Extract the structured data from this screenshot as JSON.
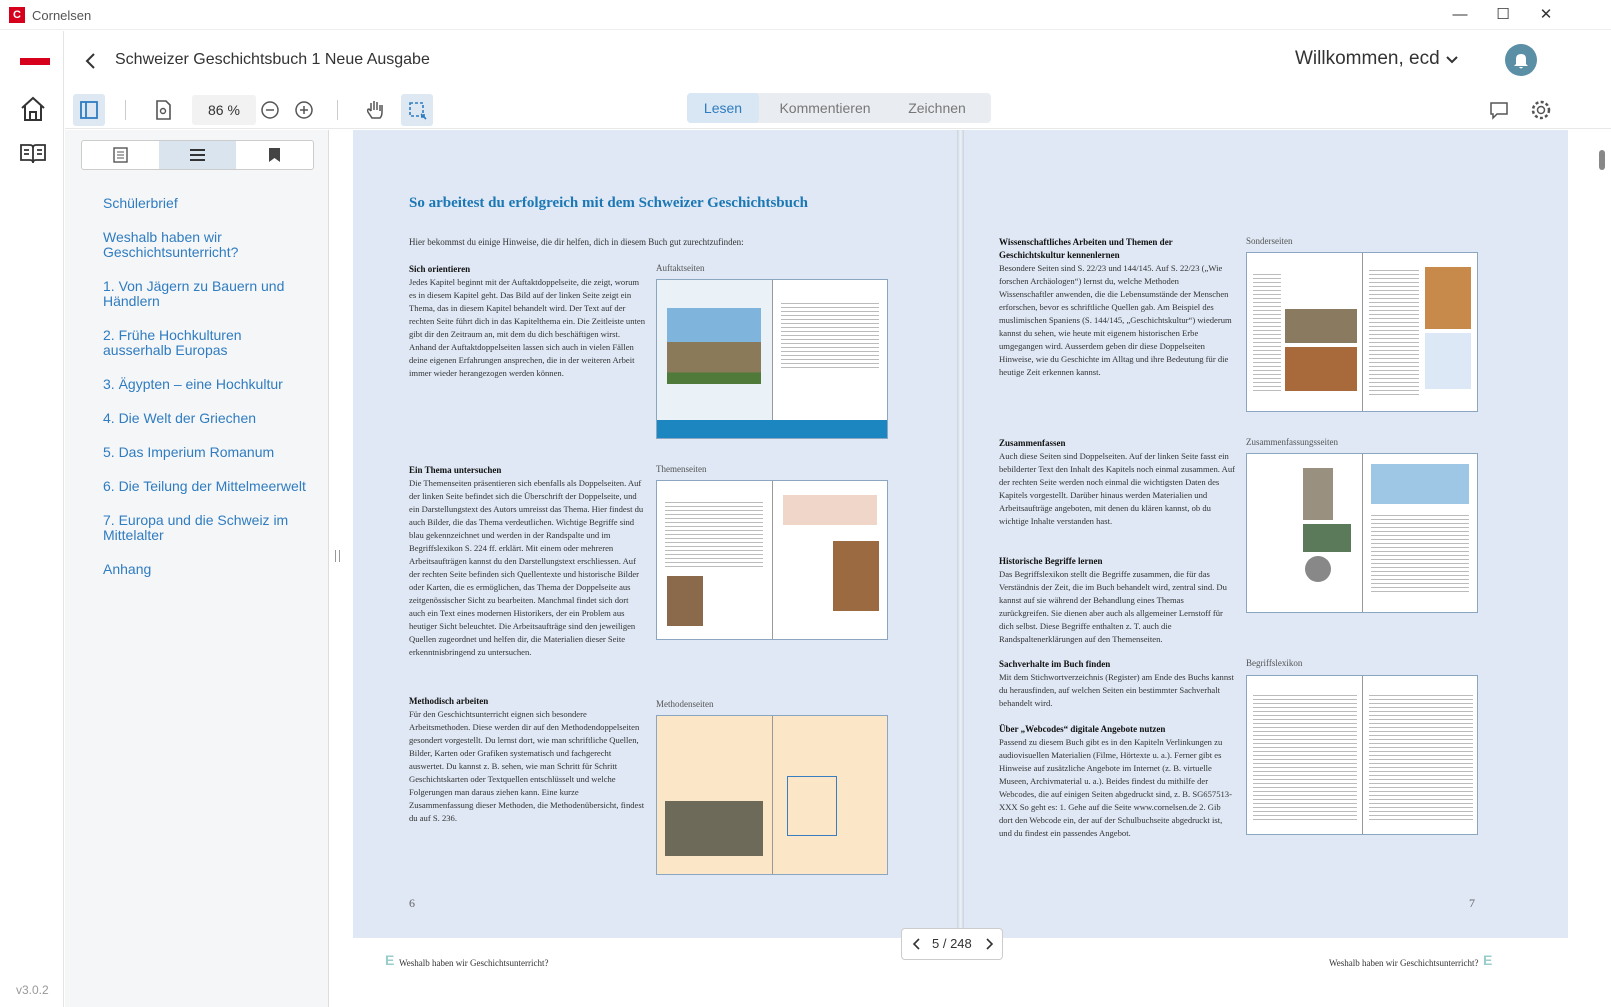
{
  "window": {
    "title": "Cornelsen",
    "logo_letter": "C",
    "minimize": "—",
    "maximize": "☐",
    "close": "✕"
  },
  "rail": {
    "version": "v3.0.2"
  },
  "header": {
    "book_title": "Schweizer Geschichtsbuch 1 Neue Ausgabe",
    "welcome": "Willkommen, ecd"
  },
  "toolbar": {
    "zoom": "86 %",
    "modes": [
      "Lesen",
      "Kommentieren",
      "Zeichnen"
    ],
    "active_mode": "Lesen"
  },
  "toc": {
    "items": [
      "Schülerbrief",
      "Weshalb haben wir Geschichtsunterricht?",
      "1. Von Jägern zu Bauern und Händlern",
      "2. Frühe Hochkulturen ausserhalb Europas",
      "3. Ägypten – eine Hochkultur",
      "4. Die Welt der Griechen",
      "5. Das Imperium Romanum",
      "6. Die Teilung der Mittelmeerwelt",
      "7. Europa und die Schweiz im Mittelalter",
      "Anhang"
    ]
  },
  "left_page": {
    "heading": "So arbeitest du erfolgreich mit dem Schweizer Geschichtsbuch",
    "intro": "Hier bekommst du einige Hinweise, die dir helfen, dich in diesem Buch gut zurechtzufinden:",
    "sections": [
      {
        "title": "Sich orientieren",
        "text": "Jedes Kapitel beginnt mit der Auftaktdoppelseite, die zeigt, worum es in diesem Kapitel geht. Das Bild auf der linken Seite zeigt ein Thema, das in diesem Kapitel behandelt wird. Der Text auf der rechten Seite führt dich in das Kapitelthema ein. Die Zeitleiste unten gibt dir den Zeitraum an, mit dem du dich beschäftigen wirst. Anhand der Auftaktdoppelseiten lassen sich auch in vielen Fällen deine eigenen Erfahrungen ansprechen, die in der weiteren Arbeit immer wieder herangezogen werden können.",
        "thumb_label": "Auftaktseiten"
      },
      {
        "title": "Ein Thema untersuchen",
        "text": "Die Themenseiten präsentieren sich ebenfalls als Doppelseiten. Auf der linken Seite befindet sich die Überschrift der Doppelseite, und ein Darstellungstext des Autors umreisst das Thema. Hier findest du auch Bilder, die das Thema verdeutlichen. Wichtige Begriffe sind blau gekennzeichnet und werden in der Randspalte und im Begriffslexikon S. 224 ff. erklärt. Mit einem oder mehreren Arbeitsaufträgen kannst du den Darstellungstext erschliessen. Auf der rechten Seite befinden sich Quellentexte und historische Bilder oder Karten, die es ermöglichen, das Thema der Doppelseite aus zeitgenössischer Sicht zu bearbeiten. Manchmal findet sich dort auch ein Text eines modernen Historikers, der ein Problem aus heutiger Sicht beleuchtet. Die Arbeitsaufträge sind den jeweiligen Quellen zugeordnet und helfen dir, die Materialien dieser Seite erkenntnisbringend zu untersuchen.",
        "thumb_label": "Themenseiten"
      },
      {
        "title": "Methodisch arbeiten",
        "text": "Für den Geschichtsunterricht eignen sich besondere Arbeitsmethoden. Diese werden dir auf den Methodendoppelseiten gesondert vorgestellt. Du lernst dort, wie man schriftliche Quellen, Bilder, Karten oder Grafiken systematisch und fachgerecht auswertet. Du kannst z. B. sehen, wie man Schritt für Schritt Geschichtskarten oder Textquellen entschlüsselt und welche Folgerungen man daraus ziehen kann. Eine kurze Zusammenfassung dieser Methoden, die Methodenübersicht, findest du auf S. 236.",
        "thumb_label": "Methodenseiten"
      }
    ],
    "page_number": "6",
    "footer": "Weshalb haben wir Geschichtsunterricht?",
    "footer_mark": "E"
  },
  "right_page": {
    "sections": [
      {
        "title": "Wissenschaftliches Arbeiten und Themen der Geschichtskultur kennenlernen",
        "text": "Besondere Seiten sind S. 22/23 und 144/145. Auf S. 22/23 („Wie forschen Archäologen“) lernst du, welche Methoden Wissenschaftler anwenden, die die Lebensumstände der Menschen erforschen, bevor es schriftliche Quellen gab. Am Beispiel des muslimischen Spaniens (S. 144/145, „Geschichtskultur“) wiederum kannst du sehen, wie heute mit eigenem historischen Erbe umgegangen wird. Ausserdem geben dir diese Doppelseiten Hinweise, wie du Geschichte im Alltag und ihre Bedeutung für die heutige Zeit erkennen kannst.",
        "thumb_label": "Sonderseiten"
      },
      {
        "title": "Zusammenfassen",
        "text": "Auch diese Seiten sind Doppelseiten. Auf der linken Seite fasst ein bebilderter Text den Inhalt des Kapitels noch einmal zusammen. Auf der rechten Seite werden noch einmal die wichtigsten Daten des Kapitels vorgestellt. Darüber hinaus werden Materialien und Arbeitsaufträge angeboten, mit denen du klären kannst, ob du wichtige Inhalte verstanden hast.",
        "thumb_label": "Zusammenfassungsseiten"
      },
      {
        "title": "Historische Begriffe lernen",
        "text": "Das Begriffslexikon stellt die Begriffe zusammen, die für das Verständnis der Zeit, die im Buch behandelt wird, zentral sind. Du kannst auf sie während der Behandlung eines Themas zurückgreifen. Sie dienen aber auch als allgemeiner Lernstoff für dich selbst. Diese Begriffe enthalten z. T. auch die Randspaltenerklärungen auf den Themenseiten.",
        "thumb_label": "Begriffslexikon"
      },
      {
        "title": "Sachverhalte im Buch finden",
        "text": "Mit dem Stichwortverzeichnis (Register) am Ende des Buchs kannst du herausfinden, auf welchen Seiten ein bestimmter Sachverhalt behandelt wird."
      },
      {
        "title": "Über „Webcodes“ digitale Angebote nutzen",
        "text": "Passend zu diesem Buch gibt es in den Kapiteln Verlinkungen zu audiovisuellen Materialien (Filme, Hörtexte u. a.). Ferner gibt es Hinweise auf zusätzliche Angebote im Internet (z. B. virtuelle Museen, Archivmaterial u. a.). Beides findest du mithilfe der Webcodes, die auf einigen Seiten abgedruckt sind, z. B. SG657513-XXX So geht es: 1. Gehe auf die Seite www.cornelsen.de 2. Gib dort den Webcode ein, der auf der Schulbuchseite abgedruckt ist, und du findest ein passendes Angebot."
      }
    ],
    "page_number": "7",
    "footer": "Weshalb haben wir Geschichtsunterricht?",
    "footer_mark": "E"
  },
  "pager": {
    "current": "5",
    "total": "248",
    "display": "5 / 248"
  },
  "colors": {
    "accent": "#2f7cc0",
    "brand": "#d6001c",
    "page_bg": "#dfe8f4"
  }
}
